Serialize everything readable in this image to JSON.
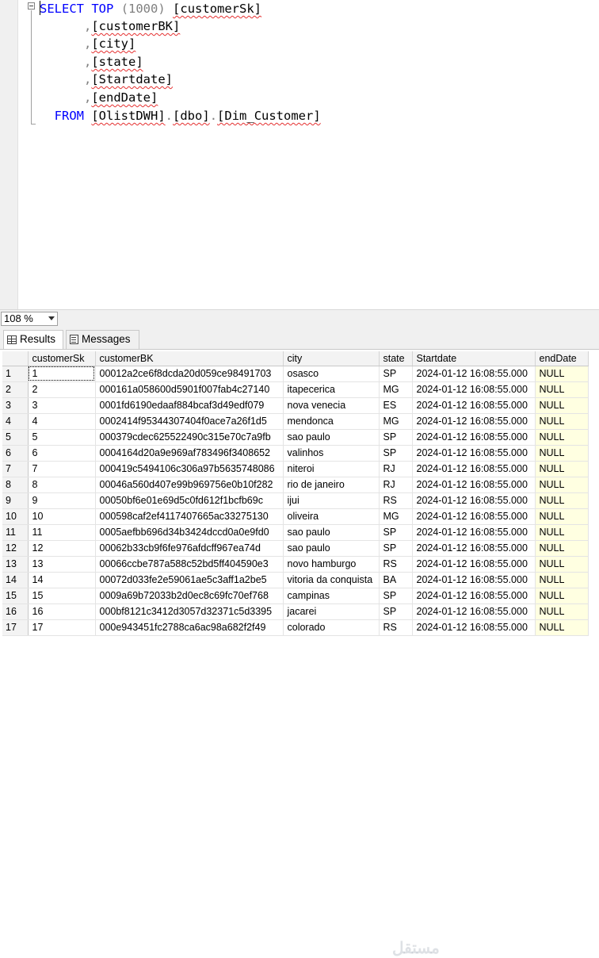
{
  "editor": {
    "lines": [
      [
        {
          "t": "SELECT",
          "c": "kw"
        },
        {
          "t": " "
        },
        {
          "t": "TOP",
          "c": "kw"
        },
        {
          "t": " ",
          "c": "gray"
        },
        {
          "t": "(1000)",
          "c": "gray"
        },
        {
          "t": " "
        },
        {
          "t": "[customerSk]",
          "c": "ident"
        }
      ],
      [
        {
          "t": "      ,",
          "c": "gray"
        },
        {
          "t": "[customerBK]",
          "c": "ident"
        }
      ],
      [
        {
          "t": "      ,",
          "c": "gray"
        },
        {
          "t": "[city]",
          "c": "ident"
        }
      ],
      [
        {
          "t": "      ,",
          "c": "gray"
        },
        {
          "t": "[state]",
          "c": "ident"
        }
      ],
      [
        {
          "t": "      ,",
          "c": "gray"
        },
        {
          "t": "[Startdate]",
          "c": "ident"
        }
      ],
      [
        {
          "t": "      ,",
          "c": "gray"
        },
        {
          "t": "[endDate]",
          "c": "ident"
        }
      ],
      [
        {
          "t": "  "
        },
        {
          "t": "FROM",
          "c": "kw"
        },
        {
          "t": " "
        },
        {
          "t": "[OlistDWH]",
          "c": "ident"
        },
        {
          "t": ".",
          "c": "gray"
        },
        {
          "t": "[dbo]",
          "c": "ident"
        },
        {
          "t": ".",
          "c": "gray"
        },
        {
          "t": "[Dim_Customer]",
          "c": "ident"
        }
      ]
    ]
  },
  "zoom": {
    "value": "108 %"
  },
  "tabs": {
    "results": "Results",
    "messages": "Messages"
  },
  "grid": {
    "columns": [
      "customerSk",
      "customerBK",
      "city",
      "state",
      "Startdate",
      "endDate"
    ],
    "rows": [
      [
        "1",
        "1",
        "00012a2ce6f8dcda20d059ce98491703",
        "osasco",
        "SP",
        "2024-01-12 16:08:55.000",
        "NULL"
      ],
      [
        "2",
        "2",
        "000161a058600d5901f007fab4c27140",
        "itapecerica",
        "MG",
        "2024-01-12 16:08:55.000",
        "NULL"
      ],
      [
        "3",
        "3",
        "0001fd6190edaaf884bcaf3d49edf079",
        "nova venecia",
        "ES",
        "2024-01-12 16:08:55.000",
        "NULL"
      ],
      [
        "4",
        "4",
        "0002414f95344307404f0ace7a26f1d5",
        "mendonca",
        "MG",
        "2024-01-12 16:08:55.000",
        "NULL"
      ],
      [
        "5",
        "5",
        "000379cdec625522490c315e70c7a9fb",
        "sao paulo",
        "SP",
        "2024-01-12 16:08:55.000",
        "NULL"
      ],
      [
        "6",
        "6",
        "0004164d20a9e969af783496f3408652",
        "valinhos",
        "SP",
        "2024-01-12 16:08:55.000",
        "NULL"
      ],
      [
        "7",
        "7",
        "000419c5494106c306a97b5635748086",
        "niteroi",
        "RJ",
        "2024-01-12 16:08:55.000",
        "NULL"
      ],
      [
        "8",
        "8",
        "00046a560d407e99b969756e0b10f282",
        "rio de janeiro",
        "RJ",
        "2024-01-12 16:08:55.000",
        "NULL"
      ],
      [
        "9",
        "9",
        "00050bf6e01e69d5c0fd612f1bcfb69c",
        "ijui",
        "RS",
        "2024-01-12 16:08:55.000",
        "NULL"
      ],
      [
        "10",
        "10",
        "000598caf2ef4117407665ac33275130",
        "oliveira",
        "MG",
        "2024-01-12 16:08:55.000",
        "NULL"
      ],
      [
        "11",
        "11",
        "0005aefbb696d34b3424dccd0a0e9fd0",
        "sao paulo",
        "SP",
        "2024-01-12 16:08:55.000",
        "NULL"
      ],
      [
        "12",
        "12",
        "00062b33cb9f6fe976afdcff967ea74d",
        "sao paulo",
        "SP",
        "2024-01-12 16:08:55.000",
        "NULL"
      ],
      [
        "13",
        "13",
        "00066ccbe787a588c52bd5ff404590e3",
        "novo hamburgo",
        "RS",
        "2024-01-12 16:08:55.000",
        "NULL"
      ],
      [
        "14",
        "14",
        "00072d033fe2e59061ae5c3aff1a2be5",
        "vitoria da conquista",
        "BA",
        "2024-01-12 16:08:55.000",
        "NULL"
      ],
      [
        "15",
        "15",
        "0009a69b72033b2d0ec8c69fc70ef768",
        "campinas",
        "SP",
        "2024-01-12 16:08:55.000",
        "NULL"
      ],
      [
        "16",
        "16",
        "000bf8121c3412d3057d32371c5d3395",
        "jacarei",
        "SP",
        "2024-01-12 16:08:55.000",
        "NULL"
      ],
      [
        "17",
        "17",
        "000e943451fc2788ca6ac98a682f2f49",
        "colorado",
        "RS",
        "2024-01-12 16:08:55.000",
        "NULL"
      ]
    ]
  },
  "colors": {
    "null_cell": "#ffffe1",
    "keyword": "#0000ff",
    "squiggle": "#e53030"
  }
}
